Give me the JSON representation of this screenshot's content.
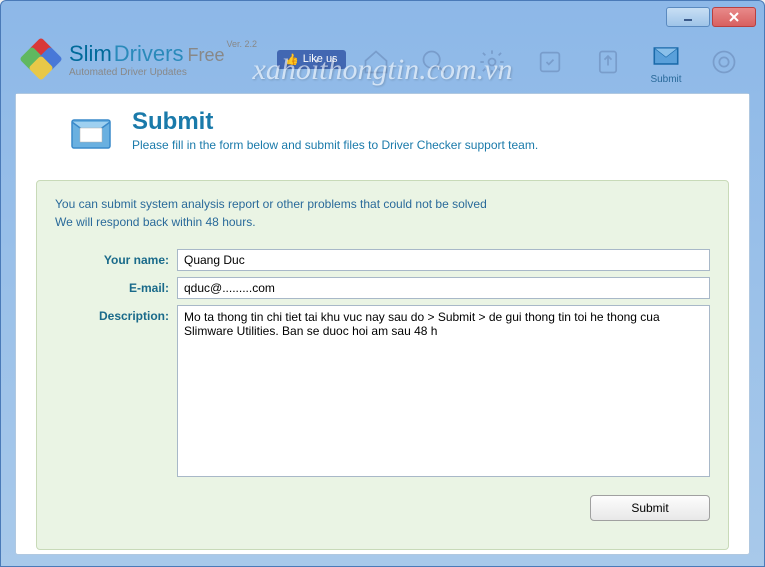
{
  "app": {
    "name_part1": "Slim",
    "name_part2": "Drivers",
    "name_part3": "Free",
    "version": "Ver. 2.2",
    "tagline": "Automated Driver Updates",
    "like_label": "Like us"
  },
  "toolbar": {
    "icons": [
      {
        "name": "home",
        "label": ""
      },
      {
        "name": "scan",
        "label": ""
      },
      {
        "name": "settings",
        "label": ""
      },
      {
        "name": "restore",
        "label": ""
      },
      {
        "name": "backup",
        "label": ""
      },
      {
        "name": "submit",
        "label": "Submit"
      },
      {
        "name": "help",
        "label": ""
      }
    ]
  },
  "page": {
    "title": "Submit",
    "subtitle": "Please fill in the form below and submit files to Driver Checker support team."
  },
  "form": {
    "info_line1": "You can submit system analysis report or other problems that could not be solved",
    "info_line2": "We will respond back within 48 hours.",
    "labels": {
      "name": "Your name:",
      "email": "E-mail:",
      "description": "Description:"
    },
    "values": {
      "name": "Quang Duc",
      "email": "qduc@.........com",
      "description": "Mo ta thong tin chi tiet tai khu vuc nay sau do > Submit > de gui thong tin toi he thong cua Slimware Utilities. Ban se duoc hoi am sau 48 h"
    },
    "submit_label": "Submit"
  },
  "watermark": "xahoithongtin.com.vn"
}
